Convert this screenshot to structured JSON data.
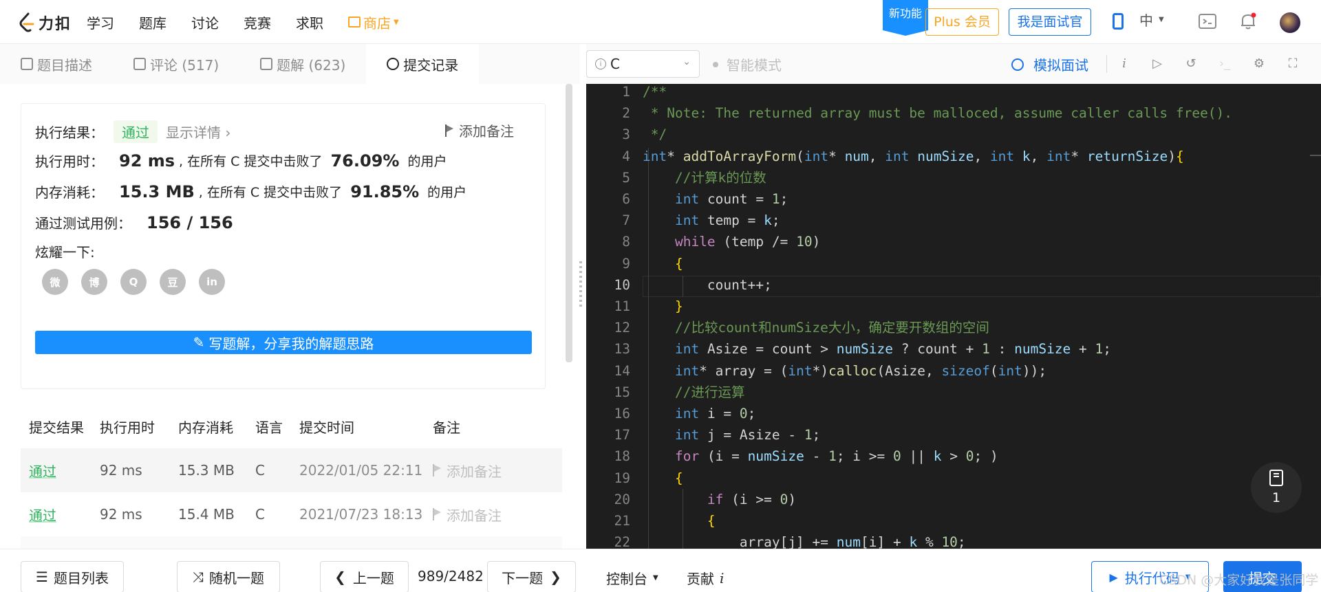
{
  "topnav": {
    "logo_text": "力扣",
    "links": [
      "学习",
      "题库",
      "讨论",
      "竞赛",
      "求职"
    ],
    "store": "商店",
    "new_badge": "新功能",
    "plus": "Plus 会员",
    "interviewer": "我是面试官",
    "lang": "中",
    "colors": {
      "accent": "#1a73e8",
      "store": "#f6a623",
      "pass": "#2db55d"
    }
  },
  "left_tabs": [
    {
      "icon": "document-icon",
      "label": "题目描述"
    },
    {
      "icon": "comment-icon",
      "label": "评论 (517)"
    },
    {
      "icon": "flask-icon",
      "label": "题解 (623)"
    },
    {
      "icon": "clock-icon",
      "label": "提交记录"
    }
  ],
  "result": {
    "status_label": "执行结果：",
    "status": "通过",
    "show_details": "显示详情",
    "add_note": "添加备注",
    "time_label": "执行用时：",
    "time_value": "92 ms",
    "time_text": ", 在所有 C 提交中击败了",
    "time_pct": "76.09%",
    "users_text": "的用户",
    "mem_label": "内存消耗：",
    "mem_value": "15.3 MB",
    "mem_text": ", 在所有 C 提交中击败了",
    "mem_pct": "91.85%",
    "tests_label": "通过测试用例：",
    "tests_value": "156 / 156",
    "share_label": "炫耀一下:",
    "share_icons": [
      "wechat-icon",
      "weibo-icon",
      "qq-icon",
      "douban-icon",
      "linkedin-icon"
    ],
    "share_glyphs": [
      "微",
      "博",
      "Q",
      "豆",
      "in"
    ],
    "write_btn": "写题解，分享我的解题思路"
  },
  "submissions": {
    "headers": [
      "提交结果",
      "执行用时",
      "内存消耗",
      "语言",
      "提交时间",
      "备注"
    ],
    "rows": [
      {
        "result": "通过",
        "time": "92 ms",
        "memory": "15.3 MB",
        "lang": "C",
        "submitted": "2022/01/05 22:11",
        "note": "添加备注"
      },
      {
        "result": "通过",
        "time": "92 ms",
        "memory": "15.4 MB",
        "lang": "C",
        "submitted": "2021/07/23 18:13",
        "note": "添加备注"
      }
    ]
  },
  "editor_toolbar": {
    "language": "C",
    "smart_mode": "智能模式",
    "mock_interview": "模拟面试",
    "icons": [
      "info-icon",
      "run-icon",
      "reset-icon",
      "terminal-icon",
      "settings-icon",
      "fullscreen-icon"
    ]
  },
  "code_lines": [
    "/**",
    " * Note: The returned array must be malloced, assume caller calls free().",
    " */",
    "int* addToArrayForm(int* num, int numSize, int k, int* returnSize){",
    "    //计算k的位数",
    "    int count = 1;",
    "    int temp = k;",
    "    while (temp /= 10)",
    "    {",
    "        count++;",
    "    }",
    "    //比较count和numSize大小，确定要开数组的空间",
    "    int Asize = count > numSize ? count + 1 : numSize + 1;",
    "    int* array = (int*)calloc(Asize, sizeof(int));",
    "    //进行运算",
    "    int i = 0;",
    "    int j = Asize - 1;",
    "    for (i = numSize - 1; i >= 0 || k > 0; )",
    "    {",
    "        if (i >= 0)",
    "        {",
    "            array[j] += num[i] + k % 10;"
  ],
  "current_line": 10,
  "float_badge_count": "1",
  "bottombar": {
    "problem_list": "题目列表",
    "random": "随机一题",
    "prev": "上一题",
    "pager": "989/2482",
    "next": "下一题",
    "console": "控制台",
    "contribute": "贡献",
    "run": "执行代码",
    "submit": "提交"
  },
  "watermark": "CSDN @大家好我是张同学"
}
